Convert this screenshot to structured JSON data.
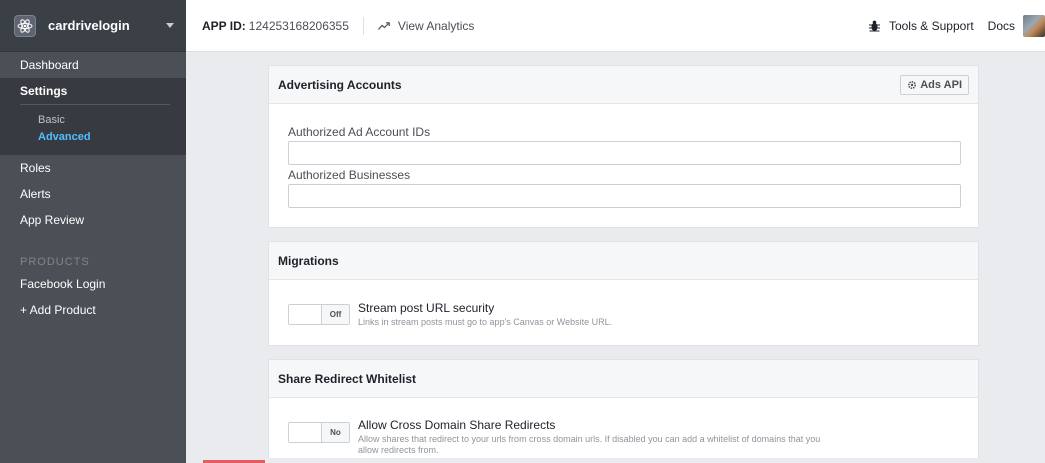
{
  "sidebar": {
    "app_name": "cardrivelogin",
    "items": {
      "dashboard": "Dashboard",
      "settings": "Settings",
      "basic": "Basic",
      "advanced": "Advanced",
      "roles": "Roles",
      "alerts": "Alerts",
      "app_review": "App Review"
    },
    "products_label": "PRODUCTS",
    "facebook_login": "Facebook Login",
    "add_product": "+ Add Product"
  },
  "topbar": {
    "app_id_label": "APP ID:",
    "app_id_value": "124253168206355",
    "analytics": "View Analytics",
    "tools": "Tools & Support",
    "docs": "Docs"
  },
  "advertising": {
    "title": "Advertising Accounts",
    "ads_api": "Ads API",
    "ad_account_label": "Authorized Ad Account IDs",
    "ad_account_value": "",
    "businesses_label": "Authorized Businesses",
    "businesses_value": ""
  },
  "migrations": {
    "title": "Migrations",
    "toggle_label": "Off",
    "option_title": "Stream post URL security",
    "option_desc": "Links in stream posts must go to app's Canvas or Website URL."
  },
  "share_redirect": {
    "title": "Share Redirect Whitelist",
    "toggle_label": "No",
    "option_title": "Allow Cross Domain Share Redirects",
    "option_desc": "Allow shares that redirect to your urls from cross domain urls. If disabled you can add a whitelist of domains that you allow redirects from."
  },
  "colors": {
    "sidebar_bg": "#4b4f56",
    "sidebar_active_bg": "#373a40",
    "accent": "#4fc0ff",
    "page_bg": "#e9ebee"
  },
  "icons": [
    "app-logo-icon",
    "chevron-down-icon",
    "analytics-icon",
    "bug-icon",
    "gear-icon"
  ]
}
